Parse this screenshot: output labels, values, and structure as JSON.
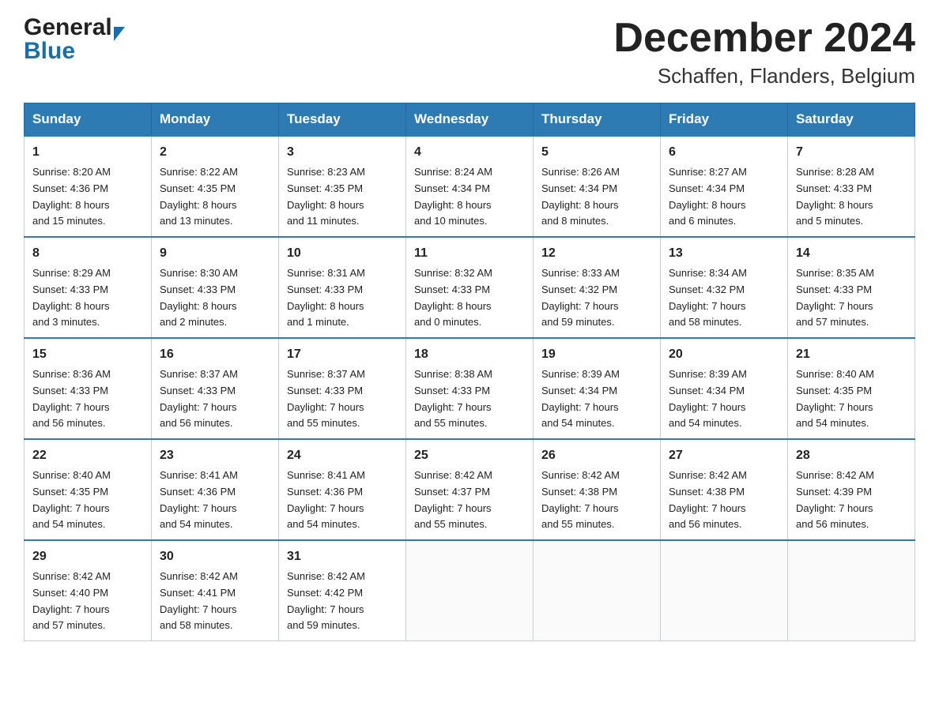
{
  "logo": {
    "general": "General",
    "blue": "Blue"
  },
  "title": {
    "month_year": "December 2024",
    "location": "Schaffen, Flanders, Belgium"
  },
  "weekdays": [
    "Sunday",
    "Monday",
    "Tuesday",
    "Wednesday",
    "Thursday",
    "Friday",
    "Saturday"
  ],
  "weeks": [
    [
      {
        "day": "1",
        "info": "Sunrise: 8:20 AM\nSunset: 4:36 PM\nDaylight: 8 hours\nand 15 minutes."
      },
      {
        "day": "2",
        "info": "Sunrise: 8:22 AM\nSunset: 4:35 PM\nDaylight: 8 hours\nand 13 minutes."
      },
      {
        "day": "3",
        "info": "Sunrise: 8:23 AM\nSunset: 4:35 PM\nDaylight: 8 hours\nand 11 minutes."
      },
      {
        "day": "4",
        "info": "Sunrise: 8:24 AM\nSunset: 4:34 PM\nDaylight: 8 hours\nand 10 minutes."
      },
      {
        "day": "5",
        "info": "Sunrise: 8:26 AM\nSunset: 4:34 PM\nDaylight: 8 hours\nand 8 minutes."
      },
      {
        "day": "6",
        "info": "Sunrise: 8:27 AM\nSunset: 4:34 PM\nDaylight: 8 hours\nand 6 minutes."
      },
      {
        "day": "7",
        "info": "Sunrise: 8:28 AM\nSunset: 4:33 PM\nDaylight: 8 hours\nand 5 minutes."
      }
    ],
    [
      {
        "day": "8",
        "info": "Sunrise: 8:29 AM\nSunset: 4:33 PM\nDaylight: 8 hours\nand 3 minutes."
      },
      {
        "day": "9",
        "info": "Sunrise: 8:30 AM\nSunset: 4:33 PM\nDaylight: 8 hours\nand 2 minutes."
      },
      {
        "day": "10",
        "info": "Sunrise: 8:31 AM\nSunset: 4:33 PM\nDaylight: 8 hours\nand 1 minute."
      },
      {
        "day": "11",
        "info": "Sunrise: 8:32 AM\nSunset: 4:33 PM\nDaylight: 8 hours\nand 0 minutes."
      },
      {
        "day": "12",
        "info": "Sunrise: 8:33 AM\nSunset: 4:32 PM\nDaylight: 7 hours\nand 59 minutes."
      },
      {
        "day": "13",
        "info": "Sunrise: 8:34 AM\nSunset: 4:32 PM\nDaylight: 7 hours\nand 58 minutes."
      },
      {
        "day": "14",
        "info": "Sunrise: 8:35 AM\nSunset: 4:33 PM\nDaylight: 7 hours\nand 57 minutes."
      }
    ],
    [
      {
        "day": "15",
        "info": "Sunrise: 8:36 AM\nSunset: 4:33 PM\nDaylight: 7 hours\nand 56 minutes."
      },
      {
        "day": "16",
        "info": "Sunrise: 8:37 AM\nSunset: 4:33 PM\nDaylight: 7 hours\nand 56 minutes."
      },
      {
        "day": "17",
        "info": "Sunrise: 8:37 AM\nSunset: 4:33 PM\nDaylight: 7 hours\nand 55 minutes."
      },
      {
        "day": "18",
        "info": "Sunrise: 8:38 AM\nSunset: 4:33 PM\nDaylight: 7 hours\nand 55 minutes."
      },
      {
        "day": "19",
        "info": "Sunrise: 8:39 AM\nSunset: 4:34 PM\nDaylight: 7 hours\nand 54 minutes."
      },
      {
        "day": "20",
        "info": "Sunrise: 8:39 AM\nSunset: 4:34 PM\nDaylight: 7 hours\nand 54 minutes."
      },
      {
        "day": "21",
        "info": "Sunrise: 8:40 AM\nSunset: 4:35 PM\nDaylight: 7 hours\nand 54 minutes."
      }
    ],
    [
      {
        "day": "22",
        "info": "Sunrise: 8:40 AM\nSunset: 4:35 PM\nDaylight: 7 hours\nand 54 minutes."
      },
      {
        "day": "23",
        "info": "Sunrise: 8:41 AM\nSunset: 4:36 PM\nDaylight: 7 hours\nand 54 minutes."
      },
      {
        "day": "24",
        "info": "Sunrise: 8:41 AM\nSunset: 4:36 PM\nDaylight: 7 hours\nand 54 minutes."
      },
      {
        "day": "25",
        "info": "Sunrise: 8:42 AM\nSunset: 4:37 PM\nDaylight: 7 hours\nand 55 minutes."
      },
      {
        "day": "26",
        "info": "Sunrise: 8:42 AM\nSunset: 4:38 PM\nDaylight: 7 hours\nand 55 minutes."
      },
      {
        "day": "27",
        "info": "Sunrise: 8:42 AM\nSunset: 4:38 PM\nDaylight: 7 hours\nand 56 minutes."
      },
      {
        "day": "28",
        "info": "Sunrise: 8:42 AM\nSunset: 4:39 PM\nDaylight: 7 hours\nand 56 minutes."
      }
    ],
    [
      {
        "day": "29",
        "info": "Sunrise: 8:42 AM\nSunset: 4:40 PM\nDaylight: 7 hours\nand 57 minutes."
      },
      {
        "day": "30",
        "info": "Sunrise: 8:42 AM\nSunset: 4:41 PM\nDaylight: 7 hours\nand 58 minutes."
      },
      {
        "day": "31",
        "info": "Sunrise: 8:42 AM\nSunset: 4:42 PM\nDaylight: 7 hours\nand 59 minutes."
      },
      {
        "day": "",
        "info": ""
      },
      {
        "day": "",
        "info": ""
      },
      {
        "day": "",
        "info": ""
      },
      {
        "day": "",
        "info": ""
      }
    ]
  ]
}
